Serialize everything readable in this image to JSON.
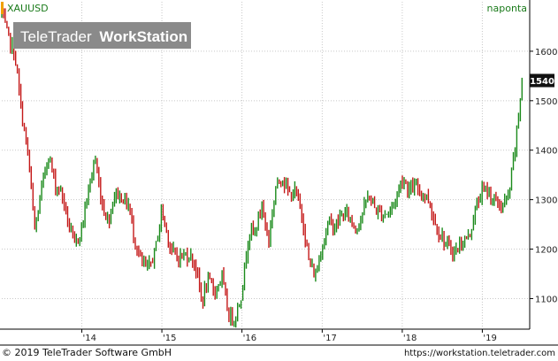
{
  "symbol": "XAUUSD",
  "period": "naponta",
  "watermark": {
    "brand": "TeleTrader",
    "product": "WorkStation"
  },
  "footer": {
    "copyright": "© 2019 TeleTrader Software GmbH",
    "url": "https://workstation.teletrader.com"
  },
  "colors": {
    "background": "#ffffff",
    "grid": "#c8c8c8",
    "up": "#1b8a1b",
    "down": "#c41818",
    "symbol_text": "#1a7a1a",
    "axis_text": "#222222",
    "price_label_bg": "#111111",
    "price_label_text": "#ffffff",
    "watermark_bg": "#8a8a8a",
    "watermark_text": "#ffffff",
    "marker": "#f0a000"
  },
  "chart_data": {
    "type": "line",
    "style": "candlestick",
    "series": [
      {
        "name": "XAUUSD",
        "x": [
          "2013-01",
          "2013-02",
          "2013-03",
          "2013-04",
          "2013-05",
          "2013-06",
          "2013-07",
          "2013-08",
          "2013-09",
          "2013-10",
          "2013-11",
          "2013-12",
          "2014-01",
          "2014-02",
          "2014-03",
          "2014-04",
          "2014-05",
          "2014-06",
          "2014-07",
          "2014-08",
          "2014-09",
          "2014-10",
          "2014-11",
          "2014-12",
          "2015-01",
          "2015-02",
          "2015-03",
          "2015-04",
          "2015-05",
          "2015-06",
          "2015-07",
          "2015-08",
          "2015-09",
          "2015-10",
          "2015-11",
          "2015-12",
          "2016-01",
          "2016-02",
          "2016-03",
          "2016-04",
          "2016-05",
          "2016-06",
          "2016-07",
          "2016-08",
          "2016-09",
          "2016-10",
          "2016-11",
          "2016-12",
          "2017-01",
          "2017-02",
          "2017-03",
          "2017-04",
          "2017-05",
          "2017-06",
          "2017-07",
          "2017-08",
          "2017-09",
          "2017-10",
          "2017-11",
          "2017-12",
          "2018-01",
          "2018-02",
          "2018-03",
          "2018-04",
          "2018-05",
          "2018-06",
          "2018-07",
          "2018-08",
          "2018-09",
          "2018-10",
          "2018-11",
          "2018-12",
          "2019-01",
          "2019-02",
          "2019-03",
          "2019-04",
          "2019-05",
          "2019-06",
          "2019-07"
        ],
        "y": [
          1675,
          1625,
          1595,
          1475,
          1390,
          1235,
          1320,
          1395,
          1330,
          1315,
          1250,
          1205,
          1245,
          1320,
          1385,
          1295,
          1255,
          1315,
          1305,
          1290,
          1215,
          1170,
          1160,
          1195,
          1280,
          1215,
          1185,
          1185,
          1190,
          1172,
          1095,
          1135,
          1115,
          1145,
          1065,
          1060,
          1115,
          1235,
          1235,
          1290,
          1215,
          1320,
          1350,
          1310,
          1315,
          1270,
          1175,
          1145,
          1210,
          1255,
          1245,
          1270,
          1270,
          1240,
          1270,
          1310,
          1280,
          1270,
          1275,
          1300,
          1345,
          1320,
          1325,
          1315,
          1300,
          1250,
          1225,
          1200,
          1195,
          1215,
          1225,
          1280,
          1320,
          1315,
          1295,
          1285,
          1305,
          1410,
          1540
        ]
      }
    ],
    "x_ticks": [
      "'14",
      "'15",
      "'16",
      "'17",
      "'18",
      "'19"
    ],
    "y_ticks": [
      1100,
      1200,
      1300,
      1400,
      1500,
      1600
    ],
    "ylim": [
      1040,
      1700
    ],
    "last_value_label": "1540",
    "grid": true
  }
}
